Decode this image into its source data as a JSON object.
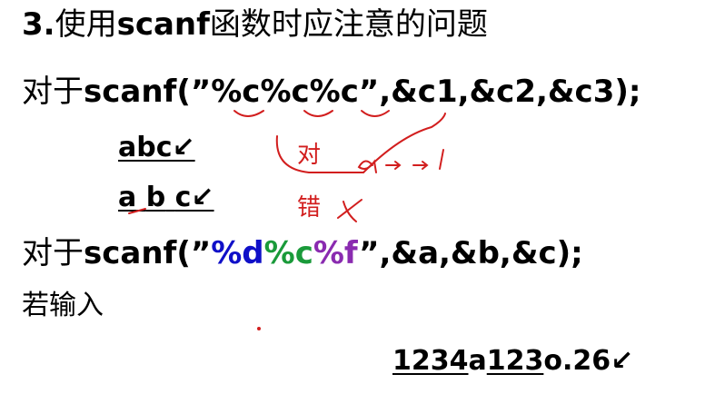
{
  "title": {
    "number": "3.",
    "t1": "使用",
    "kw": "scanf",
    "t2": "函数时应注意的问题"
  },
  "line1": {
    "prefix": "对于",
    "code": "scanf(”%c%c%c”,&c1,&c2,&c3);"
  },
  "line2": {
    "text": "abc↙"
  },
  "line3": {
    "a": "a",
    "b": "b",
    "c": "c↙"
  },
  "annot": {
    "correct": "对",
    "wrong": "错"
  },
  "line4": {
    "prefix": "对于",
    "head": "scanf(”",
    "fmt_d": "%d",
    "fmt_c": "%c",
    "fmt_f": "%f",
    "tail": "”,&a,&b,&c);"
  },
  "line5": {
    "text": "若输入"
  },
  "line6": {
    "p1": "1234",
    "p2": "a",
    "p3": "123",
    "p4": "o.26↙"
  },
  "colors": {
    "ink_red": "#d21e1e",
    "fmt_blue": "#1010c8",
    "fmt_green": "#1a9a3a",
    "fmt_purple": "#8a2bb0"
  }
}
